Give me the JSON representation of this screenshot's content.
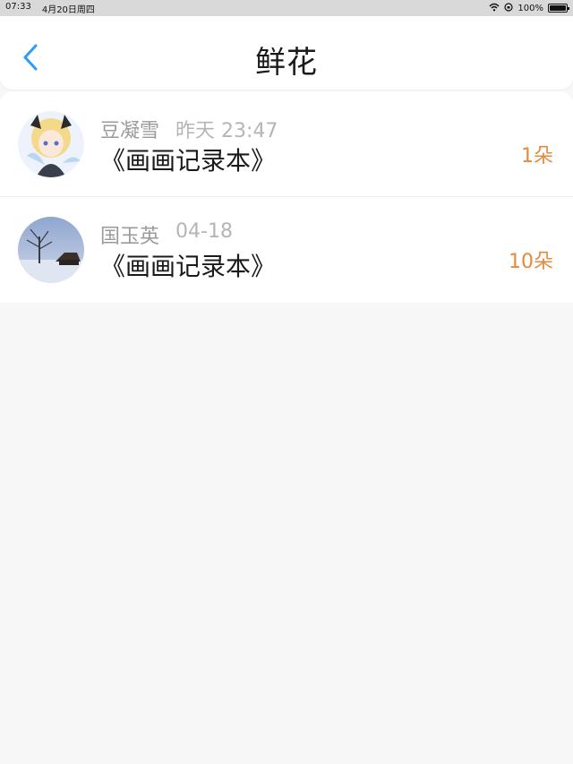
{
  "status_bar": {
    "time": "07:33",
    "date": "4月20日周四",
    "battery": "100%",
    "battery_level": 1.0
  },
  "nav": {
    "title": "鲜花"
  },
  "items": [
    {
      "name": "豆凝雪",
      "time": "昨天 23:47",
      "title": "《画画记录本》",
      "count": "1朵"
    },
    {
      "name": "国玉英",
      "time": "04-18",
      "title": "《画画记录本》",
      "count": "10朵"
    }
  ],
  "colors": {
    "accent": "#2f9cf3",
    "count": "#e58a3b",
    "background": "#f8f7f8"
  }
}
